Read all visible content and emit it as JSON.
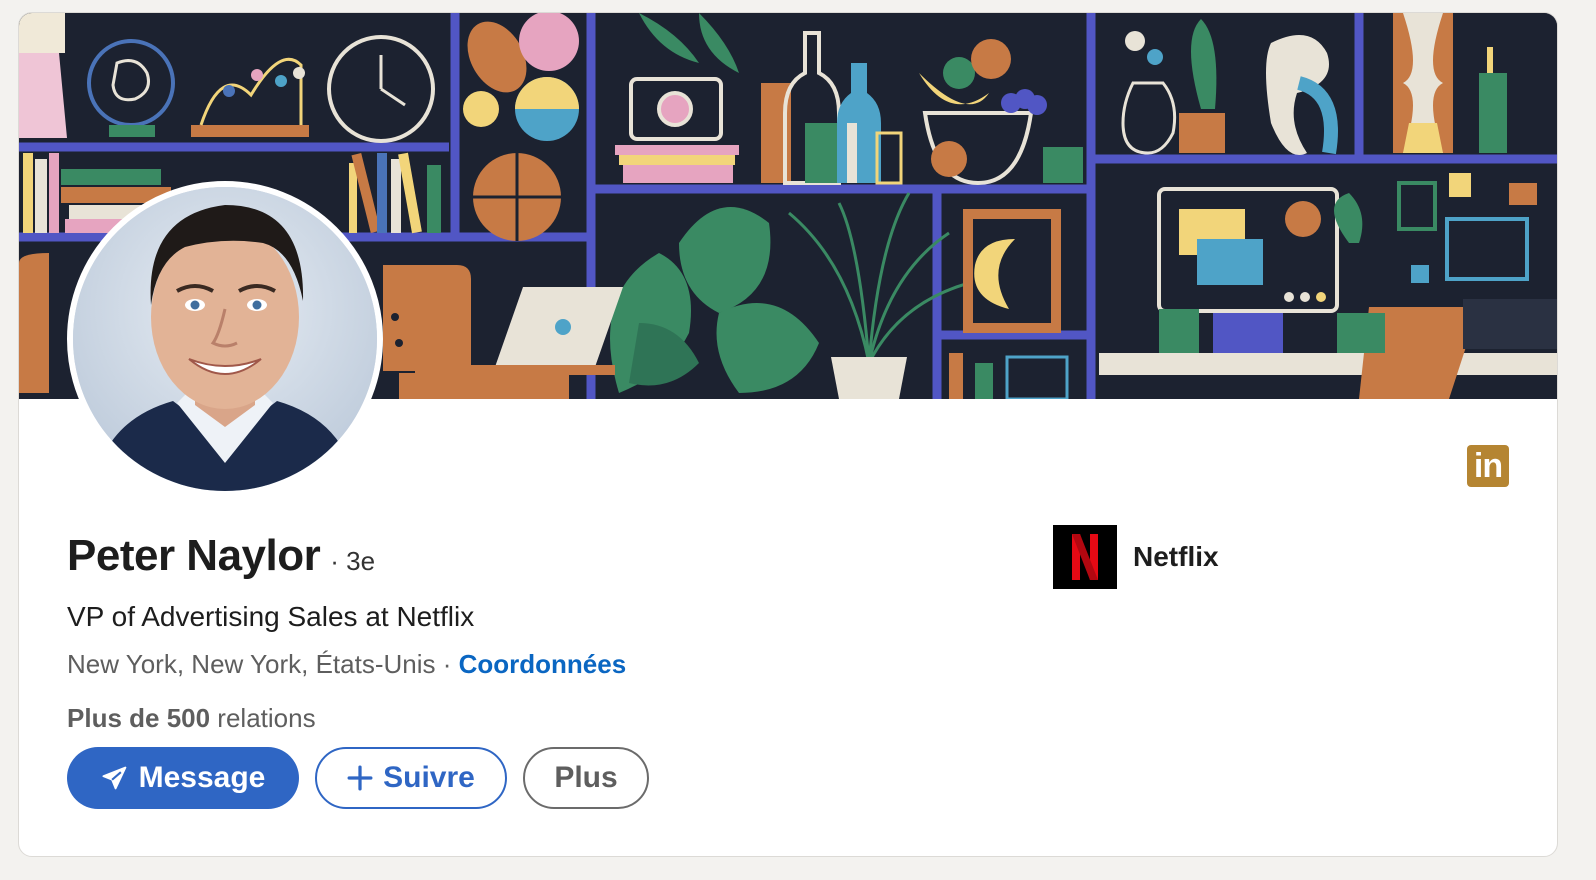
{
  "profile": {
    "name": "Peter Naylor",
    "degree": "· 3e",
    "headline": "VP of Advertising Sales at Netflix",
    "location": "New York, New York, États-Unis",
    "separator": " · ",
    "contact_link": "Coordonnées",
    "relations_bold": "Plus de 500",
    "relations_rest": " relations"
  },
  "actions": {
    "message_label": "Message",
    "follow_label": "Suivre",
    "more_label": "Plus"
  },
  "company": {
    "name": "Netflix",
    "logo_letter": "N"
  },
  "badge": {
    "label": "in"
  },
  "colors": {
    "primary_blue": "#2f66c4",
    "link_blue": "#0a66c2",
    "linkedin_badge": "#b58532",
    "netflix_red": "#e50914"
  }
}
